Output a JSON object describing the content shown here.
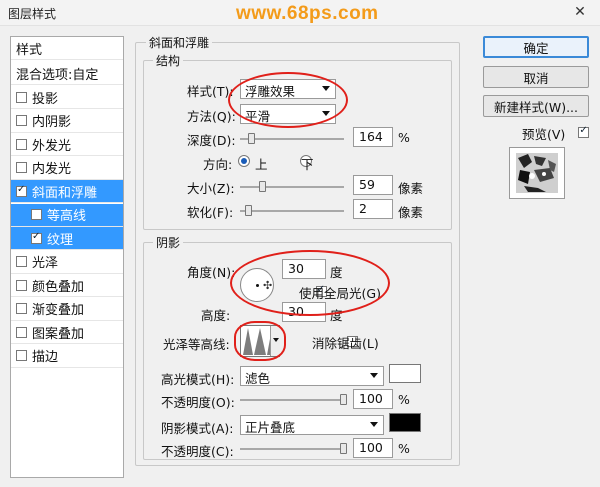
{
  "window": {
    "title": "图层样式",
    "watermark": "www.68ps.com",
    "close": "✕"
  },
  "left_panel": {
    "header": "样式",
    "blend": "混合选项:自定",
    "items": [
      {
        "label": "投影",
        "checked": false
      },
      {
        "label": "内阴影",
        "checked": false
      },
      {
        "label": "外发光",
        "checked": false
      },
      {
        "label": "内发光",
        "checked": false
      },
      {
        "label": "斜面和浮雕",
        "checked": true,
        "selected": true
      },
      {
        "label": "等高线",
        "checked": false,
        "sub": true
      },
      {
        "label": "纹理",
        "checked": true,
        "sub": true
      },
      {
        "label": "光泽",
        "checked": false
      },
      {
        "label": "颜色叠加",
        "checked": false
      },
      {
        "label": "渐变叠加",
        "checked": false
      },
      {
        "label": "图案叠加",
        "checked": false
      },
      {
        "label": "描边",
        "checked": false
      }
    ]
  },
  "bevel": {
    "section_title": "斜面和浮雕",
    "structure": {
      "title": "结构",
      "style_label": "样式(T):",
      "style_value": "浮雕效果",
      "technique_label": "方法(Q):",
      "technique_value": "平滑",
      "depth_label": "深度(D):",
      "depth_value": "164",
      "depth_unit": "%",
      "depth_level": 0.08,
      "direction_label": "方向:",
      "direction_up": "上",
      "direction_down": "下",
      "direction_selected": "上",
      "size_label": "大小(Z):",
      "size_value": "59",
      "size_unit": "像素",
      "size_level": 0.2,
      "soften_label": "软化(F):",
      "soften_value": "2",
      "soften_unit": "像素",
      "soften_level": 0.05
    },
    "shading": {
      "title": "阴影",
      "angle_label": "角度(N):",
      "angle_value": "30",
      "angle_unit": "度",
      "global_light_label": "使用全局光(G)",
      "global_light_checked": true,
      "altitude_label": "高度:",
      "altitude_value": "30",
      "altitude_unit": "度",
      "gloss_contour_label": "光泽等高线:",
      "anti_aliased_label": "消除锯齿(L)",
      "anti_aliased_checked": false,
      "highlight_mode_label": "高光模式(H):",
      "highlight_mode_value": "滤色",
      "highlight_color": "#ffffff",
      "highlight_opacity_label": "不透明度(O):",
      "highlight_opacity_value": "100",
      "highlight_opacity_unit": "%",
      "shadow_mode_label": "阴影模式(A):",
      "shadow_mode_value": "正片叠底",
      "shadow_color": "#000000",
      "shadow_opacity_label": "不透明度(C):",
      "shadow_opacity_value": "100",
      "shadow_opacity_unit": "%"
    }
  },
  "right_panel": {
    "ok": "确定",
    "cancel": "取消",
    "new_style": "新建样式(W)...",
    "preview_label": "预览(V)",
    "preview_checked": true
  },
  "colors": {
    "selection": "#3399ff",
    "annotation": "#e0201a",
    "watermark": "#f39b1a"
  }
}
